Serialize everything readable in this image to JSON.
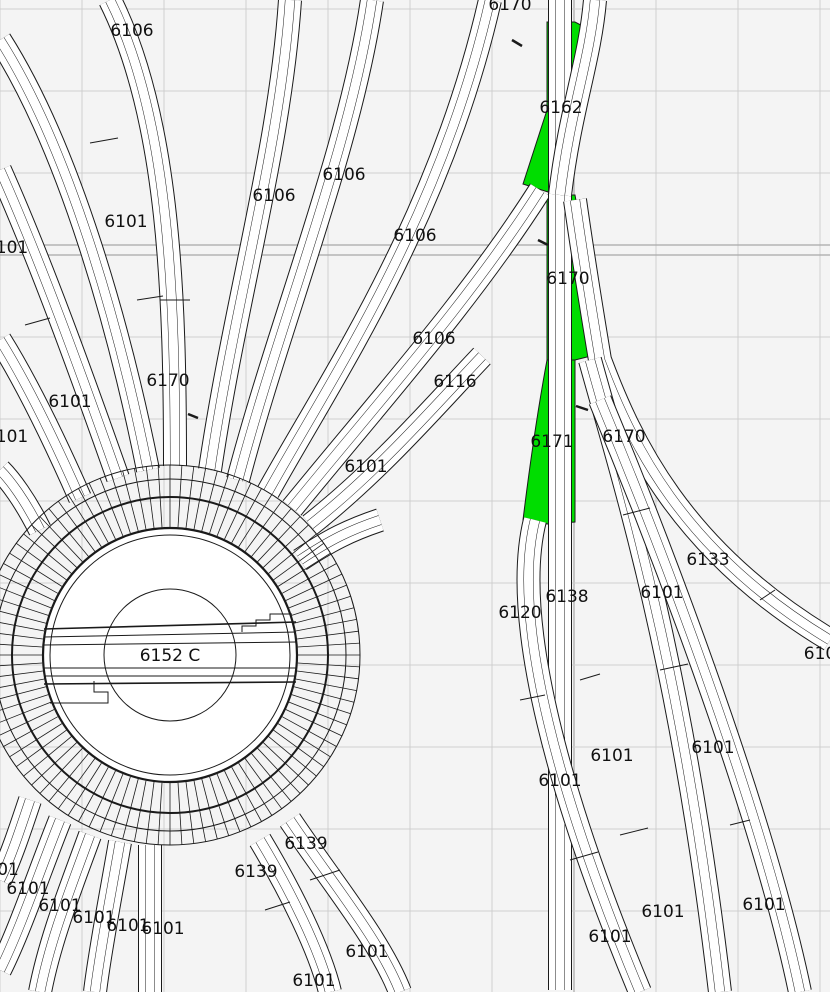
{
  "layout": {
    "selection_color": "#00dd00",
    "background_color": "#f4f4f4",
    "track_color": "#1a1a1a"
  },
  "turntable": {
    "label": "6152 C"
  },
  "labels": [
    {
      "id": "l1",
      "text": "6106"
    },
    {
      "id": "l2",
      "text": "6170"
    },
    {
      "id": "l3",
      "text": "6162"
    },
    {
      "id": "l4",
      "text": "6106"
    },
    {
      "id": "l5",
      "text": "6106"
    },
    {
      "id": "l6",
      "text": "6101"
    },
    {
      "id": "l7",
      "text": "101"
    },
    {
      "id": "l8",
      "text": "6106"
    },
    {
      "id": "l9",
      "text": "6170"
    },
    {
      "id": "l10",
      "text": "6106"
    },
    {
      "id": "l11",
      "text": "6116"
    },
    {
      "id": "l12",
      "text": "6170"
    },
    {
      "id": "l13",
      "text": "6101"
    },
    {
      "id": "l14",
      "text": "101"
    },
    {
      "id": "l15",
      "text": "6171"
    },
    {
      "id": "l16",
      "text": "6170"
    },
    {
      "id": "l17",
      "text": "6101"
    },
    {
      "id": "l18",
      "text": "6133"
    },
    {
      "id": "l19",
      "text": "6101"
    },
    {
      "id": "l20",
      "text": "6138"
    },
    {
      "id": "l21",
      "text": "6120"
    },
    {
      "id": "l22",
      "text": "610"
    },
    {
      "id": "l23",
      "text": "6101"
    },
    {
      "id": "l24",
      "text": "6101"
    },
    {
      "id": "l25",
      "text": "6101"
    },
    {
      "id": "l26",
      "text": "6139"
    },
    {
      "id": "l27",
      "text": "6139"
    },
    {
      "id": "l28",
      "text": "01"
    },
    {
      "id": "l29",
      "text": "6101"
    },
    {
      "id": "l30",
      "text": "6101"
    },
    {
      "id": "l31",
      "text": "6101"
    },
    {
      "id": "l32",
      "text": "6101"
    },
    {
      "id": "l33",
      "text": "6101"
    },
    {
      "id": "l34",
      "text": "6101"
    },
    {
      "id": "l35",
      "text": "6101"
    },
    {
      "id": "l36",
      "text": "6101"
    },
    {
      "id": "l37",
      "text": "6101"
    },
    {
      "id": "l38",
      "text": "6101"
    }
  ]
}
